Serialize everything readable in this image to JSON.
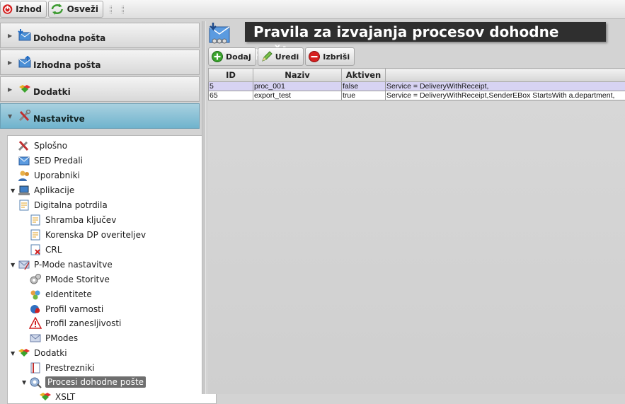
{
  "toolbar": {
    "exit_label": "Izhod",
    "refresh_label": "Osveži"
  },
  "sidebar": {
    "sections": [
      {
        "label": "Dohodna pošta",
        "icon": "inbox-icon"
      },
      {
        "label": "Izhodna pošta",
        "icon": "outbox-icon"
      },
      {
        "label": "Dodatki",
        "icon": "puzzle-icon"
      },
      {
        "label": "Nastavitve",
        "icon": "tools-icon"
      }
    ],
    "tree": [
      {
        "label": "Splošno"
      },
      {
        "label": "SED Predali"
      },
      {
        "label": "Uporabniki"
      },
      {
        "label": "Aplikacije"
      },
      {
        "label": "Digitalna potrdila"
      },
      {
        "label": "Shramba ključev"
      },
      {
        "label": "Korenska DP overiteljev"
      },
      {
        "label": "CRL"
      },
      {
        "label": "P-Mode nastavitve"
      },
      {
        "label": "PMode Storitve"
      },
      {
        "label": "eIdentitete"
      },
      {
        "label": "Profil varnosti"
      },
      {
        "label": "Profil zanesljivosti"
      },
      {
        "label": "PModes"
      },
      {
        "label": "Dodatki"
      },
      {
        "label": "Prestrezniki"
      },
      {
        "label": "Procesi dohodne pošte"
      },
      {
        "label": "XSLT"
      }
    ]
  },
  "main": {
    "title": "Pravila za izvajanja procesov dohodne pošte",
    "actions": {
      "add_label": "Dodaj",
      "edit_label": "Uredi",
      "delete_label": "Izbriši"
    },
    "table": {
      "columns": [
        "ID",
        "Naziv",
        "Aktiven",
        ""
      ],
      "rows": [
        {
          "id": "5",
          "name": "proc_001",
          "active": "false",
          "rule": "Service = DeliveryWithReceipt,"
        },
        {
          "id": "65",
          "name": "export_test",
          "active": "true",
          "rule": "Service = DeliveryWithReceipt,SenderEBox StartsWith a.department,"
        }
      ]
    }
  },
  "colors": {
    "accent_active": "#7fbcd3",
    "selected_row": "#d7d3f3",
    "title_bg": "#2f2f2f"
  }
}
